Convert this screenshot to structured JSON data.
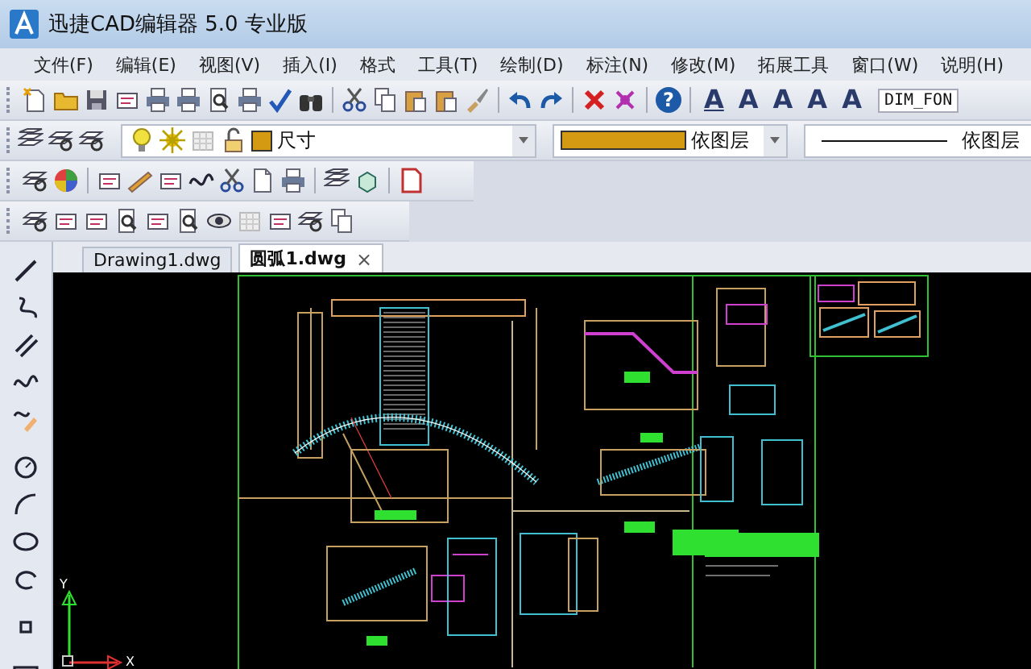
{
  "window": {
    "title": "迅捷CAD编辑器 5.0 专业版"
  },
  "menu": [
    "文件(F)",
    "编辑(E)",
    "视图(V)",
    "插入(I)",
    "格式",
    "工具(T)",
    "绘制(D)",
    "标注(N)",
    "修改(M)",
    "拓展工具",
    "窗口(W)",
    "说明(H)"
  ],
  "toolbar": {
    "help_glyph": "?",
    "text_glyphs": [
      "A",
      "A",
      "A",
      "A",
      "A"
    ],
    "dim_style_field": {
      "value": "DIM_FON"
    }
  },
  "layer_bar": {
    "layer": {
      "value": "尺寸",
      "color": "#d49a12"
    },
    "color_combo": {
      "value": "依图层",
      "color": "#d49a12"
    },
    "linetype_combo": {
      "value": "依图层"
    }
  },
  "tabs": [
    {
      "label": "Drawing1.dwg",
      "selected": false
    },
    {
      "label": "圆弧1.dwg",
      "selected": true,
      "close": "×"
    }
  ],
  "canvas": {
    "axis_labels": {
      "y": "Y",
      "x": "X"
    }
  }
}
